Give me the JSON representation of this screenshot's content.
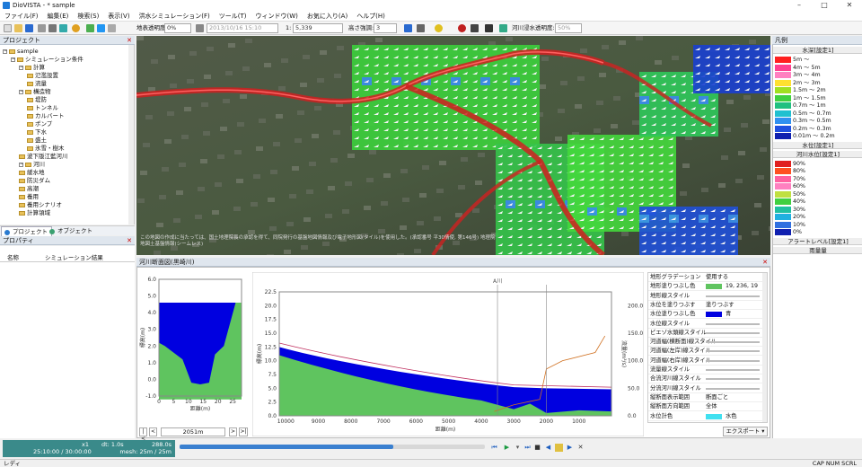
{
  "window": {
    "title": "DioVISTA - * sample",
    "minimize": "–",
    "maximize": "□",
    "close": "✕"
  },
  "menu": [
    "ファイル(F)",
    "編集(E)",
    "検索(S)",
    "表示(V)",
    "洪水シミュレーション(F)",
    "ツール(T)",
    "ウィンドウ(W)",
    "お気に入り(A)",
    "ヘルプ(H)"
  ],
  "toolbar": {
    "terrain_label": "地表透明度:",
    "terrain_value": "0%",
    "datetime_value": "2013/10/16 15:10",
    "scale_prefix": "1:",
    "scale_value": "5,339",
    "height_label": "高さ強調:",
    "height_value": "3",
    "river_label": "河川浸水透明度:",
    "river_value": "50%"
  },
  "project_panel": {
    "title": "プロジェクト",
    "items": [
      {
        "label": "sample",
        "indent": 0,
        "type": "root"
      },
      {
        "label": "シミュレーション条件",
        "indent": 1,
        "type": "folder"
      },
      {
        "label": "計算",
        "indent": 2,
        "type": "folder"
      },
      {
        "label": "氾濫設置",
        "indent": 3,
        "type": "item"
      },
      {
        "label": "流量",
        "indent": 3,
        "type": "item"
      },
      {
        "label": "構造物",
        "indent": 2,
        "type": "folder"
      },
      {
        "label": "堤防",
        "indent": 3,
        "type": "item"
      },
      {
        "label": "トンネル",
        "indent": 3,
        "type": "item"
      },
      {
        "label": "カルバート",
        "indent": 3,
        "type": "item"
      },
      {
        "label": "ポンプ",
        "indent": 3,
        "type": "item"
      },
      {
        "label": "下水",
        "indent": 3,
        "type": "item"
      },
      {
        "label": "盛土",
        "indent": 3,
        "type": "item"
      },
      {
        "label": "氷雪・樹木",
        "indent": 3,
        "type": "item"
      },
      {
        "label": "波下版江藍河川",
        "indent": 2,
        "type": "item"
      },
      {
        "label": "河川",
        "indent": 2,
        "type": "folder"
      },
      {
        "label": "緩水地",
        "indent": 2,
        "type": "item"
      },
      {
        "label": "防災ダム",
        "indent": 2,
        "type": "item"
      },
      {
        "label": "高潮",
        "indent": 2,
        "type": "item"
      },
      {
        "label": "養用",
        "indent": 2,
        "type": "item"
      },
      {
        "label": "養用シナリオ",
        "indent": 2,
        "type": "item"
      },
      {
        "label": "計算領域",
        "indent": 2,
        "type": "item"
      }
    ],
    "tab_project": "プロジェクト",
    "tab_object": "オブジェクト"
  },
  "properties_panel": {
    "title": "プロパティ",
    "col_name": "名称",
    "col_value": "シミュレーション結果"
  },
  "map": {
    "attribution": "この地図の作成に当たっては、国土地理院長の承認を得て、同院発行の基盤地図情報及び電子地形図(タイル)を使用した。(承認番号 平30情使, 第146号) 地理院地図土基盤情報(シームレス)"
  },
  "legend": {
    "title": "凡例",
    "depth_header": "水深[設定1]",
    "depth_items": [
      {
        "label": "5m ～",
        "color": "#ff2020"
      },
      {
        "label": "4m ～ 5m",
        "color": "#ff4090"
      },
      {
        "label": "3m ～ 4m",
        "color": "#ff80c0"
      },
      {
        "label": "2m ～ 3m",
        "color": "#ffe030"
      },
      {
        "label": "1.5m ～ 2m",
        "color": "#a0e020"
      },
      {
        "label": "1m ～ 1.5m",
        "color": "#40d040"
      },
      {
        "label": "0.7m ～ 1m",
        "color": "#20c080"
      },
      {
        "label": "0.5m ～ 0.7m",
        "color": "#20c0d0"
      },
      {
        "label": "0.3m ～ 0.5m",
        "color": "#3090f0"
      },
      {
        "label": "0.2m ～ 0.3m",
        "color": "#2050e0"
      },
      {
        "label": "0.01m ～ 0.2m",
        "color": "#1020b0"
      }
    ],
    "level_header": "水位[設定1]",
    "river_header": "河川水位[設定1]",
    "river_items": [
      {
        "label": "90%",
        "color": "#e02020"
      },
      {
        "label": "80%",
        "color": "#ff5020"
      },
      {
        "label": "70%",
        "color": "#ff60a0"
      },
      {
        "label": "60%",
        "color": "#ff80c0"
      },
      {
        "label": "50%",
        "color": "#c0e040"
      },
      {
        "label": "40%",
        "color": "#40d040"
      },
      {
        "label": "30%",
        "color": "#20c0a0"
      },
      {
        "label": "20%",
        "color": "#20b0e0"
      },
      {
        "label": "10%",
        "color": "#3070e0"
      },
      {
        "label": "0%",
        "color": "#1020b0"
      }
    ],
    "alert_header": "アラートレベル[設定1]",
    "rain_header": "雨量量"
  },
  "river_panel": {
    "title": "河川断面図(黒崎川)",
    "cross_section": {
      "yticks": [
        "6.0",
        "5.0",
        "4.0",
        "3.0",
        "2.0",
        "1.0",
        "0.0",
        "-1.0"
      ],
      "xticks": [
        "0",
        "5",
        "10",
        "15",
        "20",
        "25"
      ],
      "ylabel": "標高(m)",
      "xlabel": "距離(m)"
    },
    "nav": {
      "first": "|<",
      "prev": "<",
      "value": "2051m",
      "next": ">",
      "last": ">|"
    },
    "profile": {
      "yticks_left": [
        "22.5",
        "20.0",
        "17.5",
        "15.0",
        "12.5",
        "10.0",
        "7.5",
        "5.0",
        "2.5",
        "0.0"
      ],
      "yticks_right": [
        "200.0",
        "150.0",
        "100.0",
        "50.0",
        "0.0"
      ],
      "xticks": [
        "10000",
        "9000",
        "8000",
        "7000",
        "6000",
        "5000",
        "4000",
        "3000",
        "2000",
        "1000"
      ],
      "ylabel": "標高(m)",
      "ylabel_right": "流量(m³/s)",
      "xlabel": "距離(m)",
      "marker": "A川"
    },
    "settings": [
      {
        "k": "地形グラデーション",
        "v": "使用する"
      },
      {
        "k": "地形塗りつぶし色",
        "v": "19, 236, 19",
        "color": "#5fc45f"
      },
      {
        "k": "地形線スタイル",
        "v": ""
      },
      {
        "k": "水位を塗りつぶす",
        "v": "塗りつぶす"
      },
      {
        "k": "水位塗りつぶし色",
        "v": "青",
        "color": "#0000e0"
      },
      {
        "k": "水位線スタイル",
        "v": ""
      },
      {
        "k": "ピエゾ水頭線スタイル",
        "v": ""
      },
      {
        "k": "河道幅(横断面)線スタイル",
        "v": ""
      },
      {
        "k": "河道幅(左岸)線スタイル",
        "v": ""
      },
      {
        "k": "河道幅(右岸)線スタイル",
        "v": ""
      },
      {
        "k": "流量線スタイル",
        "v": ""
      },
      {
        "k": "合流河川線スタイル",
        "v": ""
      },
      {
        "k": "分流河川線スタイル",
        "v": ""
      },
      {
        "k": "縦断面表示範囲",
        "v": "断面ごと"
      },
      {
        "k": "縦断面方向範囲",
        "v": "全体"
      },
      {
        "k": "水位計色",
        "v": "水色",
        "color": "#40e0f0"
      }
    ],
    "export_label": "エクスポート"
  },
  "animation": {
    "speed": "x1",
    "dt": "dt: 1.0s",
    "elapsed": "288.0s",
    "time": "25:10:00 / 30:00:00",
    "mesh": "mesh: 25m / 25m",
    "progress": 0.7
  },
  "status": {
    "left": "レディ",
    "right": "CAP  NUM  SCRL"
  }
}
